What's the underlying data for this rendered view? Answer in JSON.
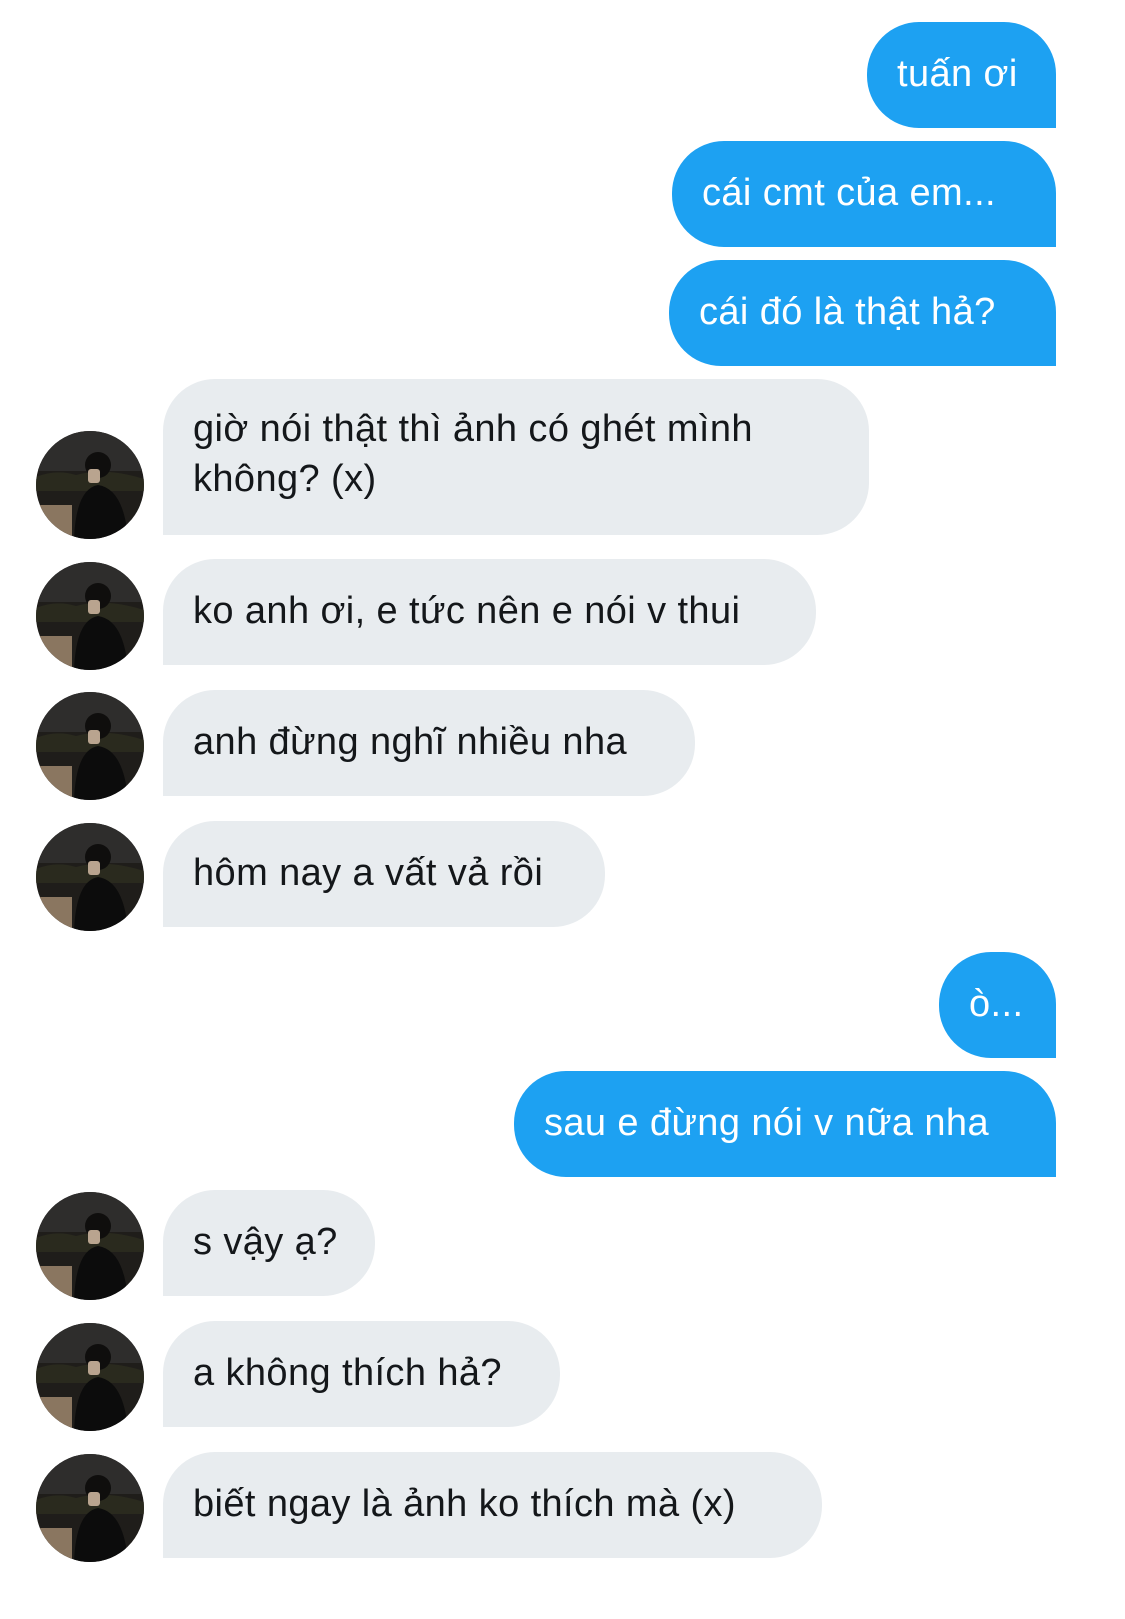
{
  "conversation": {
    "messages": [
      {
        "text": "tuấn ơi"
      },
      {
        "text": "cái cmt của em..."
      },
      {
        "text": "cái đó là thật hả?"
      },
      {
        "text": "giờ nói thật thì ảnh có ghét mình không? (x)"
      },
      {
        "text": "ko anh ơi, e tức nên e nói v thui"
      },
      {
        "text": "anh đừng nghĩ nhiều nha"
      },
      {
        "text": "hôm nay a vất vả rồi"
      },
      {
        "text": "ò..."
      },
      {
        "text": "sau e đừng nói v nữa nha"
      },
      {
        "text": "s vậy ạ?"
      },
      {
        "text": "a không thích hả?"
      },
      {
        "text": "biết ngay là ảnh ko thích mà (x)"
      }
    ]
  },
  "colors": {
    "outgoing_bubble": "#1da1f2",
    "incoming_bubble": "#e8ecef",
    "outgoing_text": "#ffffff",
    "incoming_text": "#14171a"
  },
  "icons": {
    "avatar": "avatar-photo-icon"
  }
}
